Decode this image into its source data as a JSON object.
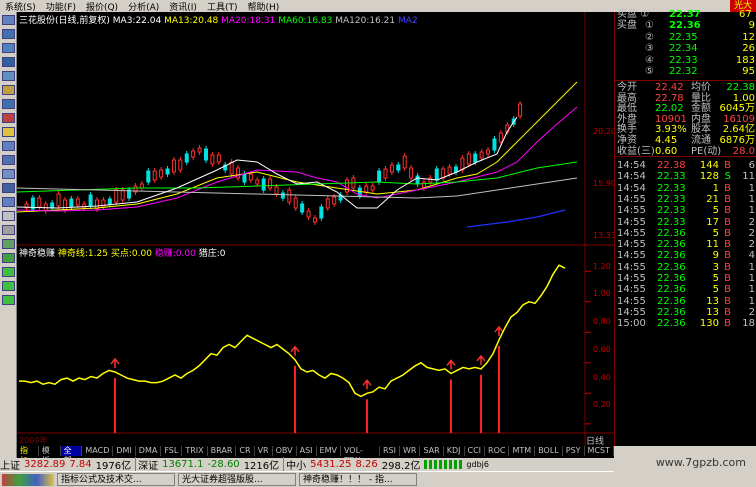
{
  "menu": {
    "items": [
      "系统(S)",
      "功能(F)",
      "报价(Q)",
      "分析(A)",
      "资讯(I)",
      "工具(T)",
      "帮助(H)"
    ],
    "brand": "光大"
  },
  "price_header": {
    "stock": "三花股份(日线,前复权)",
    "ma": [
      {
        "label": "MA3:22.04",
        "color": "#ffffff"
      },
      {
        "label": "MA13:20.48",
        "color": "#ffff00"
      },
      {
        "label": "MA20:18.31",
        "color": "#ff00ff"
      },
      {
        "label": "MA60:16.83",
        "color": "#00ff00"
      },
      {
        "label": "MA120:16.21",
        "color": "#c0c0c0"
      },
      {
        "label": "MA2",
        "color": "#4040ff"
      }
    ]
  },
  "price_axis": [
    "20.20",
    "15.90",
    "13.33"
  ],
  "ind_header": {
    "name": "神奇稳赚",
    "line1": "神奇线:1.25",
    "line2": "买点:0.00",
    "line3": "稳赚:0.00",
    "line4": "猎庄:0"
  },
  "ind_axis": [
    "1.20",
    "1.00",
    "0.80",
    "0.60",
    "0.40",
    "0.20"
  ],
  "year_label": "2009年",
  "day_label": "日线",
  "tabs": [
    "指标",
    "模板",
    "全部",
    "MACD",
    "DMI",
    "DMA",
    "FSL",
    "TRIX",
    "BRAR",
    "CR",
    "VR",
    "OBV",
    "ASI",
    "EMV",
    "VOL-TDX",
    "RSI",
    "WR",
    "SAR",
    "KDJ",
    "CCI",
    "ROC",
    "MTM",
    "BOLL",
    "PSY",
    "MCST"
  ],
  "order_book": {
    "top_partial": {
      "label": "买盘",
      "num": "①",
      "price": "22.37",
      "vol": "67"
    },
    "rows": [
      {
        "label": "买盘",
        "num": "①",
        "price": "22.36",
        "vol": "9"
      },
      {
        "label": "",
        "num": "②",
        "price": "22.35",
        "vol": "12"
      },
      {
        "label": "",
        "num": "③",
        "price": "22.34",
        "vol": "26"
      },
      {
        "label": "",
        "num": "④",
        "price": "22.33",
        "vol": "183"
      },
      {
        "label": "",
        "num": "⑤",
        "price": "22.32",
        "vol": "95"
      }
    ]
  },
  "quote": [
    {
      "k1": "今开",
      "v1": "22.42",
      "k2": "均价",
      "v2": "22.38"
    },
    {
      "k1": "最高",
      "v1": "22.78",
      "k2": "量比",
      "v2": "1.00"
    },
    {
      "k1": "最低",
      "v1": "22.02",
      "k2": "金额",
      "v2": "6045万"
    },
    {
      "k1": "外盘",
      "v1": "10901",
      "k2": "内盘",
      "v2": "16109"
    },
    {
      "k1": "换手",
      "v1": "3.93%",
      "k2": "股本",
      "v2": "2.64亿"
    },
    {
      "k1": "净资",
      "v1": "4.45",
      "k2": "流通",
      "v2": "6876万"
    },
    {
      "k1": "收益(三)",
      "v1": "0.60",
      "k2": "PE(动)",
      "v2": "28.0"
    }
  ],
  "ticks": [
    {
      "t": "14:54",
      "p": "22.38",
      "v": "144",
      "s": "B",
      "n": "6"
    },
    {
      "t": "14:54",
      "p": "22.33",
      "v": "128",
      "s": "S",
      "n": "11"
    },
    {
      "t": "14:54",
      "p": "22.33",
      "v": "1",
      "s": "B",
      "n": "1"
    },
    {
      "t": "14:55",
      "p": "22.33",
      "v": "21",
      "s": "B",
      "n": "1"
    },
    {
      "t": "14:55",
      "p": "22.33",
      "v": "5",
      "s": "B",
      "n": "1"
    },
    {
      "t": "14:55",
      "p": "22.33",
      "v": "17",
      "s": "B",
      "n": "2"
    },
    {
      "t": "14:55",
      "p": "22.36",
      "v": "5",
      "s": "B",
      "n": "2"
    },
    {
      "t": "14:55",
      "p": "22.36",
      "v": "11",
      "s": "B",
      "n": "2"
    },
    {
      "t": "14:55",
      "p": "22.36",
      "v": "9",
      "s": "B",
      "n": "4"
    },
    {
      "t": "14:55",
      "p": "22.36",
      "v": "3",
      "s": "B",
      "n": "1"
    },
    {
      "t": "14:55",
      "p": "22.36",
      "v": "5",
      "s": "B",
      "n": "1"
    },
    {
      "t": "14:55",
      "p": "22.36",
      "v": "5",
      "s": "B",
      "n": "1"
    },
    {
      "t": "14:55",
      "p": "22.36",
      "v": "13",
      "s": "B",
      "n": "1"
    },
    {
      "t": "14:55",
      "p": "22.36",
      "v": "13",
      "s": "B",
      "n": "2"
    },
    {
      "t": "15:00",
      "p": "22.36",
      "v": "130",
      "s": "B",
      "n": "18"
    }
  ],
  "status": {
    "sh_label": "上证",
    "sh_val": "3282.89",
    "sh_chg": "7.84",
    "sh_amt": "1976亿",
    "sz_label": "深证",
    "sz_val": "13671.1",
    "sz_chg": "-28.60",
    "sz_amt": "1216亿",
    "zx_label": "中小",
    "zx_val": "5431.25",
    "zx_chg": "8.26",
    "zx_amt": "298.2亿",
    "extra": "gdbj6"
  },
  "taskbar": [
    "指标公式及技术交...",
    "光大证券超强版股...",
    "神奇稳赚！！！ - 指..."
  ],
  "watermark": "www.7gpzb.com",
  "chart_data": {
    "type": "line",
    "title": "神奇稳赚",
    "series": [
      {
        "name": "神奇线",
        "values": [
          0.48,
          0.48,
          0.47,
          0.48,
          0.46,
          0.47,
          0.46,
          0.49,
          0.5,
          0.48,
          0.5,
          0.49,
          0.51,
          0.5,
          0.53,
          0.55,
          0.54,
          0.52,
          0.5,
          0.49,
          0.48,
          0.48,
          0.47,
          0.47,
          0.48,
          0.5,
          0.52,
          0.5,
          0.53,
          0.55,
          0.58,
          0.62,
          0.66,
          0.65,
          0.7,
          0.72,
          0.7,
          0.74,
          0.78,
          0.76,
          0.74,
          0.72,
          0.7,
          0.72,
          0.69,
          0.66,
          0.62,
          0.56,
          0.54,
          0.55,
          0.52,
          0.5,
          0.53,
          0.52,
          0.5,
          0.47,
          0.4,
          0.38,
          0.4,
          0.41,
          0.44,
          0.43,
          0.48,
          0.5,
          0.52,
          0.55,
          0.58,
          0.6,
          0.57,
          0.56,
          0.55,
          0.56,
          0.53,
          0.55,
          0.57,
          0.56,
          0.57,
          0.56,
          0.6,
          0.66,
          0.75,
          0.83,
          0.9,
          0.93,
          0.98,
          1.0,
          0.99,
          1.04,
          1.1,
          1.18,
          1.24,
          1.22
        ]
      }
    ],
    "buy_markers_at": [
      16,
      46,
      58,
      72,
      77,
      80
    ],
    "ylim": [
      0.14,
      1.3
    ]
  }
}
